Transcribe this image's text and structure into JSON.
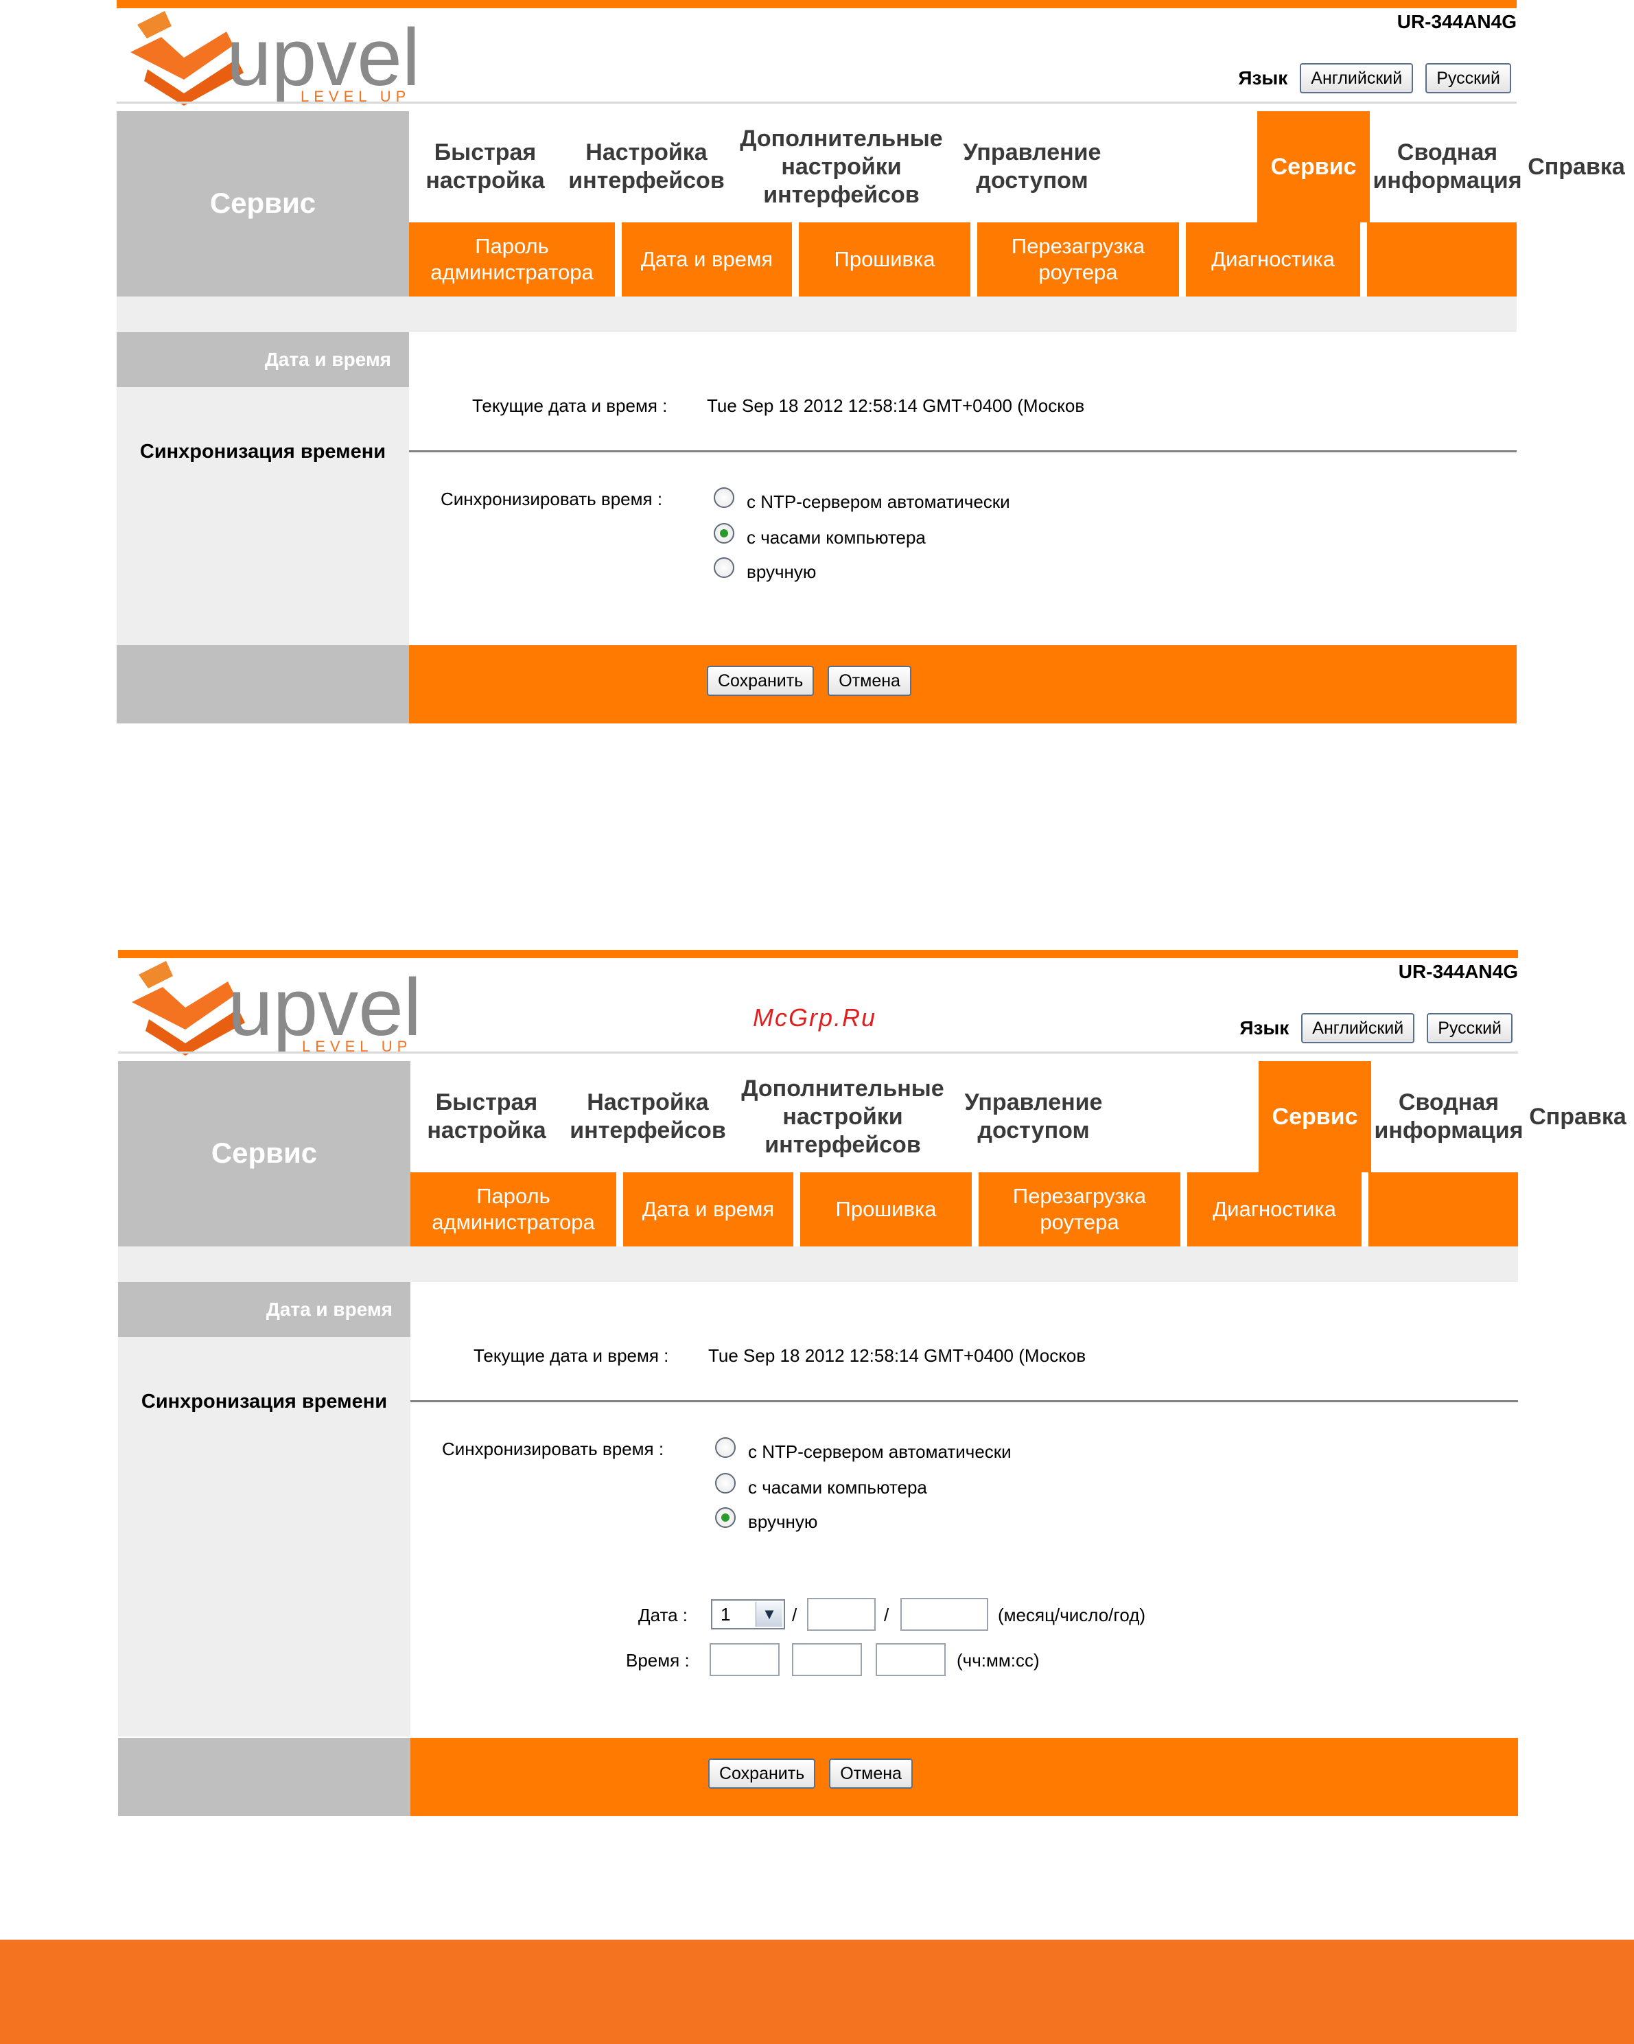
{
  "brand": {
    "logo_text": "upvel",
    "slogan": "LEVEL UP",
    "model": "UR-344AN4G",
    "colors": {
      "accent": "#FF7A00",
      "nav_gray": "#BFBFBF",
      "light_gray": "#EEEEEE",
      "footer": "#F47320"
    }
  },
  "watermark": "McGrp.Ru",
  "language": {
    "label": "Язык",
    "english": "Английский",
    "russian": "Русский"
  },
  "nav": {
    "left_title": "Сервис",
    "tabs": [
      {
        "label": "Быстрая настройка"
      },
      {
        "label": "Настройка интерфейсов"
      },
      {
        "label": "Дополнительные настройки интерфейсов"
      },
      {
        "label": "Управление доступом"
      },
      {
        "label": "Сервис"
      },
      {
        "label": "Сводная информация"
      },
      {
        "label": "Справка"
      }
    ],
    "subtabs": [
      {
        "label": "Пароль администратора"
      },
      {
        "label": "Дата и время"
      },
      {
        "label": "Прошивка"
      },
      {
        "label": "Перезагрузка роутера"
      },
      {
        "label": "Диагностика"
      }
    ]
  },
  "screen1": {
    "section_title": "Дата и время",
    "current_label": "Текущие дата и время :",
    "current_value": "Tue Sep 18 2012 12:58:14 GMT+0400 (Москов",
    "sync_section": "Синхронизация времени",
    "sync_label": "Синхронизировать время :",
    "options": [
      "с NTP-сервером автоматически",
      "с часами компьютера",
      "вручную"
    ],
    "selected": "с часами компьютера",
    "save": "Сохранить",
    "cancel": "Отмена"
  },
  "screen2": {
    "section_title": "Дата и время",
    "current_label": "Текущие дата и время :",
    "current_value": "Tue Sep 18 2012 12:58:14 GMT+0400 (Москов",
    "sync_section": "Синхронизация времени",
    "sync_label": "Синхронизировать время :",
    "options": [
      "с NTP-сервером автоматически",
      "с часами компьютера",
      "вручную"
    ],
    "selected": "вручную",
    "date_label": "Дата :",
    "month_value": "1",
    "slash": "/",
    "date_hint": "(месяц/число/год)",
    "time_label": "Время :",
    "time_hint": "(чч:мм:сс)",
    "save": "Сохранить",
    "cancel": "Отмена"
  }
}
